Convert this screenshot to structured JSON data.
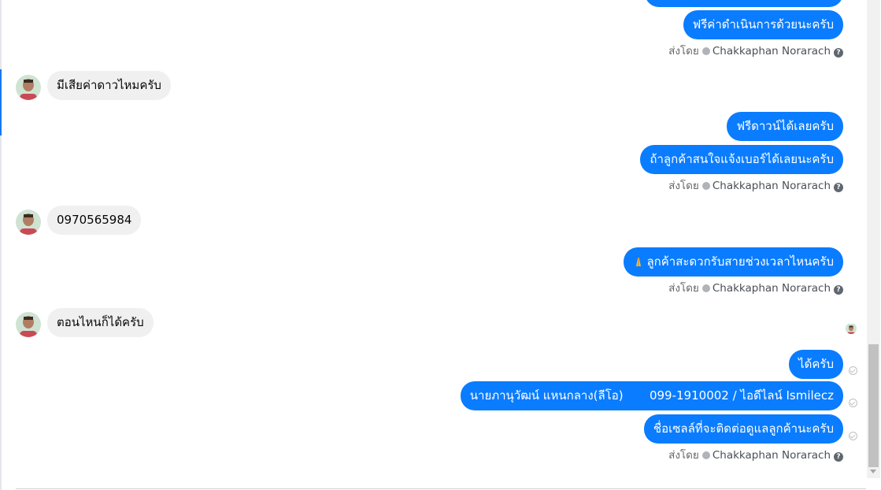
{
  "conversation": {
    "m1": "ฟรีค่าดำเนินการด้วยนะครับ",
    "m2": "มีเสียค่าดาวไหมครับ",
    "m3": "ฟรีดาวน์ได้เลยครับ",
    "m4": "ถ้าลูกค้าสนใจแจ้งเบอร์ได้เลยนะครับ",
    "m5": "0970565984",
    "m6": "ลูกค้าสะดวกรับสายช่วงเวลาไหนครับ",
    "m7": "ตอนไหนก็ได้ครับ",
    "m8": "ได้ครับ",
    "m9": "นายภานุวัฒน์ แหนกลาง(ลีโอ)       099-1910002 / ไอดีไลน์ Ismilecz",
    "m10": "ชื่อเซลล์ที่จะติดต่อดูแลลูกค้านะครับ"
  },
  "sent_by": {
    "prefix": "ส่งโดย",
    "agent": "Chakkaphan Norarach",
    "help": "?"
  },
  "icons": {
    "pray": "folded-hands-emoji",
    "delivered": "check-circle-icon",
    "sent_by": "check-circle-icon",
    "help": "question-circle-icon"
  },
  "colors": {
    "outgoing_bubble": "#0a7cff",
    "incoming_bubble": "#f0f0f0",
    "accent": "#1877f2"
  }
}
